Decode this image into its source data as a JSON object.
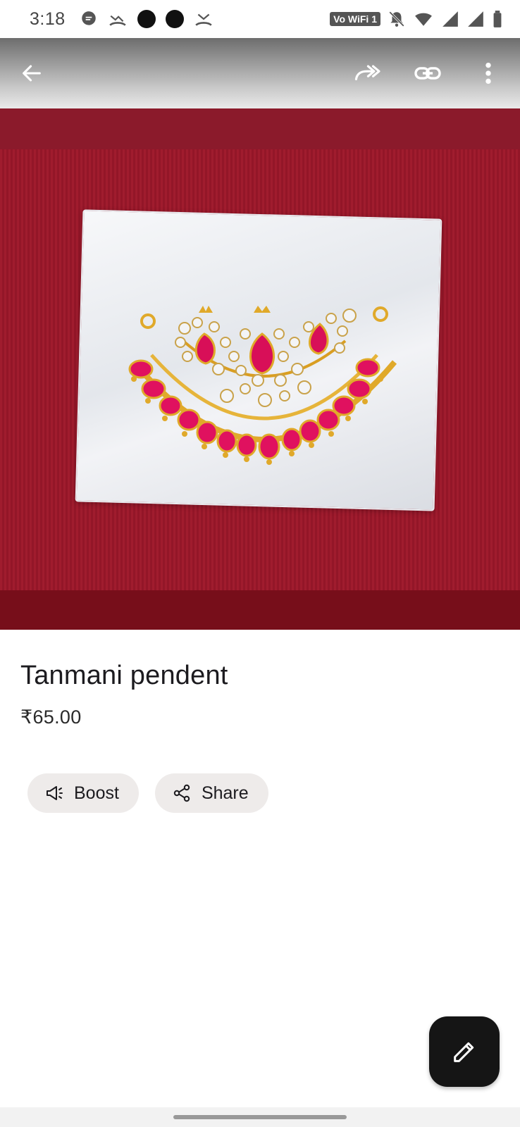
{
  "status_bar": {
    "time": "3:18",
    "wifi_label": "Vo WiFi 1",
    "icons": [
      "chat-bubble-icon",
      "missed-call-icon",
      "dot-icon",
      "dot-icon",
      "missed-call-icon",
      "bell-off-icon",
      "wifi-icon",
      "signal-icon",
      "signal-icon",
      "battery-icon"
    ]
  },
  "top_bar": {
    "icons": [
      "back-arrow-icon",
      "forward-share-icon",
      "link-icon",
      "more-vert-icon"
    ]
  },
  "product": {
    "title": "Tanmani pendent",
    "price": "₹65.00",
    "image_colors": {
      "felt": "#a01c2e",
      "gold": "#e0a92a",
      "stone": "#e0115f"
    }
  },
  "actions": {
    "boost_label": "Boost",
    "share_label": "Share"
  },
  "fab": {
    "icon": "edit-pencil-icon"
  }
}
